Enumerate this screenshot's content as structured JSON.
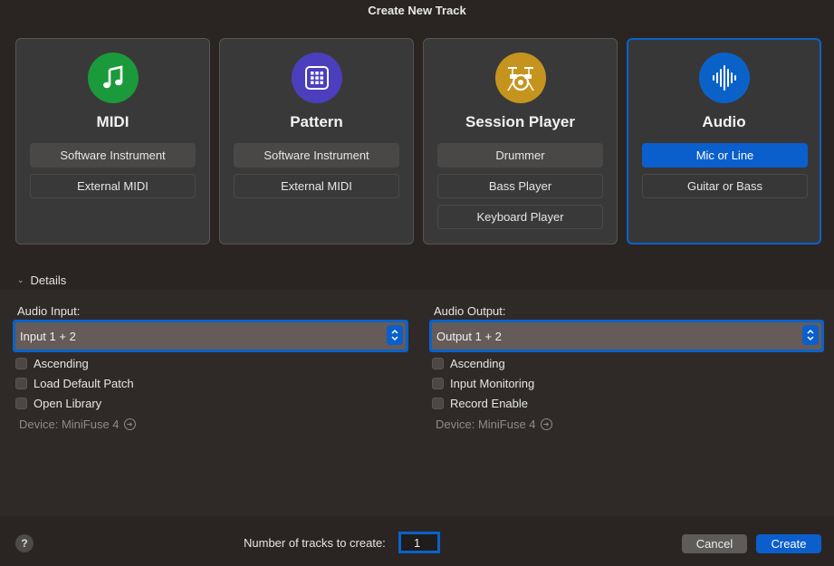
{
  "window": {
    "title": "Create New Track"
  },
  "cards": [
    {
      "title": "MIDI",
      "icon": "music-note-icon",
      "color": "#1a9a3a",
      "options": [
        "Software Instrument",
        "External MIDI"
      ]
    },
    {
      "title": "Pattern",
      "icon": "grid-icon",
      "color": "#4b3fbd",
      "options": [
        "Software Instrument",
        "External MIDI"
      ]
    },
    {
      "title": "Session Player",
      "icon": "drum-kit-icon",
      "color": "#c4941e",
      "options": [
        "Drummer",
        "Bass Player",
        "Keyboard Player"
      ]
    },
    {
      "title": "Audio",
      "icon": "waveform-icon",
      "color": "#0a62c9",
      "options": [
        "Mic or Line",
        "Guitar or Bass"
      ],
      "selected_option": "Mic or Line"
    }
  ],
  "details": {
    "toggle_label": "Details",
    "input": {
      "label": "Audio Input:",
      "value": "Input 1 + 2",
      "checkboxes": [
        "Ascending",
        "Load Default Patch",
        "Open Library"
      ],
      "device": "Device: MiniFuse 4"
    },
    "output": {
      "label": "Audio Output:",
      "value": "Output 1 + 2",
      "checkboxes": [
        "Ascending",
        "Input Monitoring",
        "Record Enable"
      ],
      "device": "Device: MiniFuse 4"
    }
  },
  "footer": {
    "help": "?",
    "count_label": "Number of tracks to create:",
    "count_value": "1",
    "cancel_label": "Cancel",
    "create_label": "Create"
  }
}
